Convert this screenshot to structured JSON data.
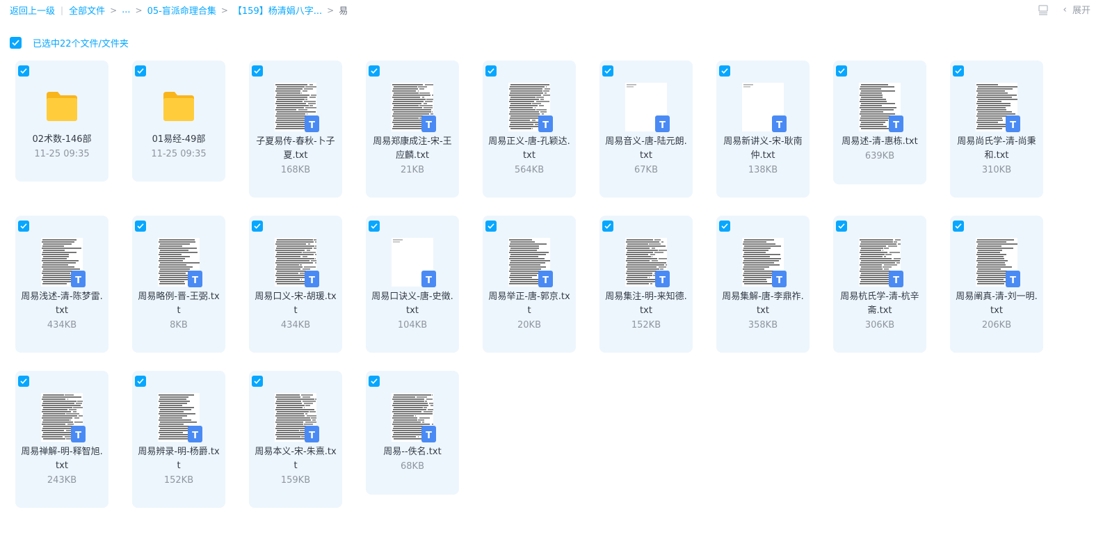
{
  "breadcrumb": {
    "back": "返回上一级",
    "root": "全部文件",
    "ellipsis": "...",
    "level1": "05-盲派命理合集",
    "level2": "【159】杨清娟八字...",
    "current": "易"
  },
  "toolbar": {
    "expand_label": "展开"
  },
  "selection": {
    "label": "已选中22个文件/文件夹"
  },
  "items": [
    {
      "type": "folder",
      "name": "02术数-146部",
      "meta": "11-25 09:35"
    },
    {
      "type": "folder",
      "name": "01易经-49部",
      "meta": "11-25 09:35"
    },
    {
      "type": "file",
      "name": "子夏易传-春秋-卜子夏.txt",
      "meta": "168KB"
    },
    {
      "type": "file",
      "name": "周易郑康成注-宋-王应麟.txt",
      "meta": "21KB"
    },
    {
      "type": "file",
      "name": "周易正义-唐-孔颖达.txt",
      "meta": "564KB"
    },
    {
      "type": "file",
      "name": "周易音义-唐-陆元朗.txt",
      "meta": "67KB"
    },
    {
      "type": "file",
      "name": "周易新讲义-宋-耿南仲.txt",
      "meta": "138KB"
    },
    {
      "type": "file",
      "name": "周易述-清-惠栋.txt",
      "meta": "639KB"
    },
    {
      "type": "file",
      "name": "周易尚氏学-清-尚秉和.txt",
      "meta": "310KB"
    },
    {
      "type": "file",
      "name": "周易浅述-清-陈梦雷.txt",
      "meta": "434KB"
    },
    {
      "type": "file",
      "name": "周易略例-晋-王弼.txt",
      "meta": "8KB"
    },
    {
      "type": "file",
      "name": "周易口义-宋-胡瑗.txt",
      "meta": "434KB"
    },
    {
      "type": "file",
      "name": "周易口诀义-唐-史徵.txt",
      "meta": "104KB"
    },
    {
      "type": "file",
      "name": "周易举正-唐-郭京.txt",
      "meta": "20KB"
    },
    {
      "type": "file",
      "name": "周易集注-明-来知德.txt",
      "meta": "152KB"
    },
    {
      "type": "file",
      "name": "周易集解-唐-李鼎祚.txt",
      "meta": "358KB"
    },
    {
      "type": "file",
      "name": "周易杭氏学-清-杭辛斋.txt",
      "meta": "306KB"
    },
    {
      "type": "file",
      "name": "周易阐真-清-刘一明.txt",
      "meta": "206KB"
    },
    {
      "type": "file",
      "name": "周易禅解-明-释智旭.txt",
      "meta": "243KB"
    },
    {
      "type": "file",
      "name": "周易辨录-明-杨爵.txt",
      "meta": "152KB"
    },
    {
      "type": "file",
      "name": "周易本义-宋-朱熹.txt",
      "meta": "159KB"
    },
    {
      "type": "file",
      "name": "周易--佚名.txt",
      "meta": "68KB"
    }
  ],
  "badge_letter": "T",
  "colors": {
    "accent": "#06a7ff",
    "card_bg": "#eef6fd",
    "folder": "#ffc73a",
    "badge": "#4a8af4"
  }
}
